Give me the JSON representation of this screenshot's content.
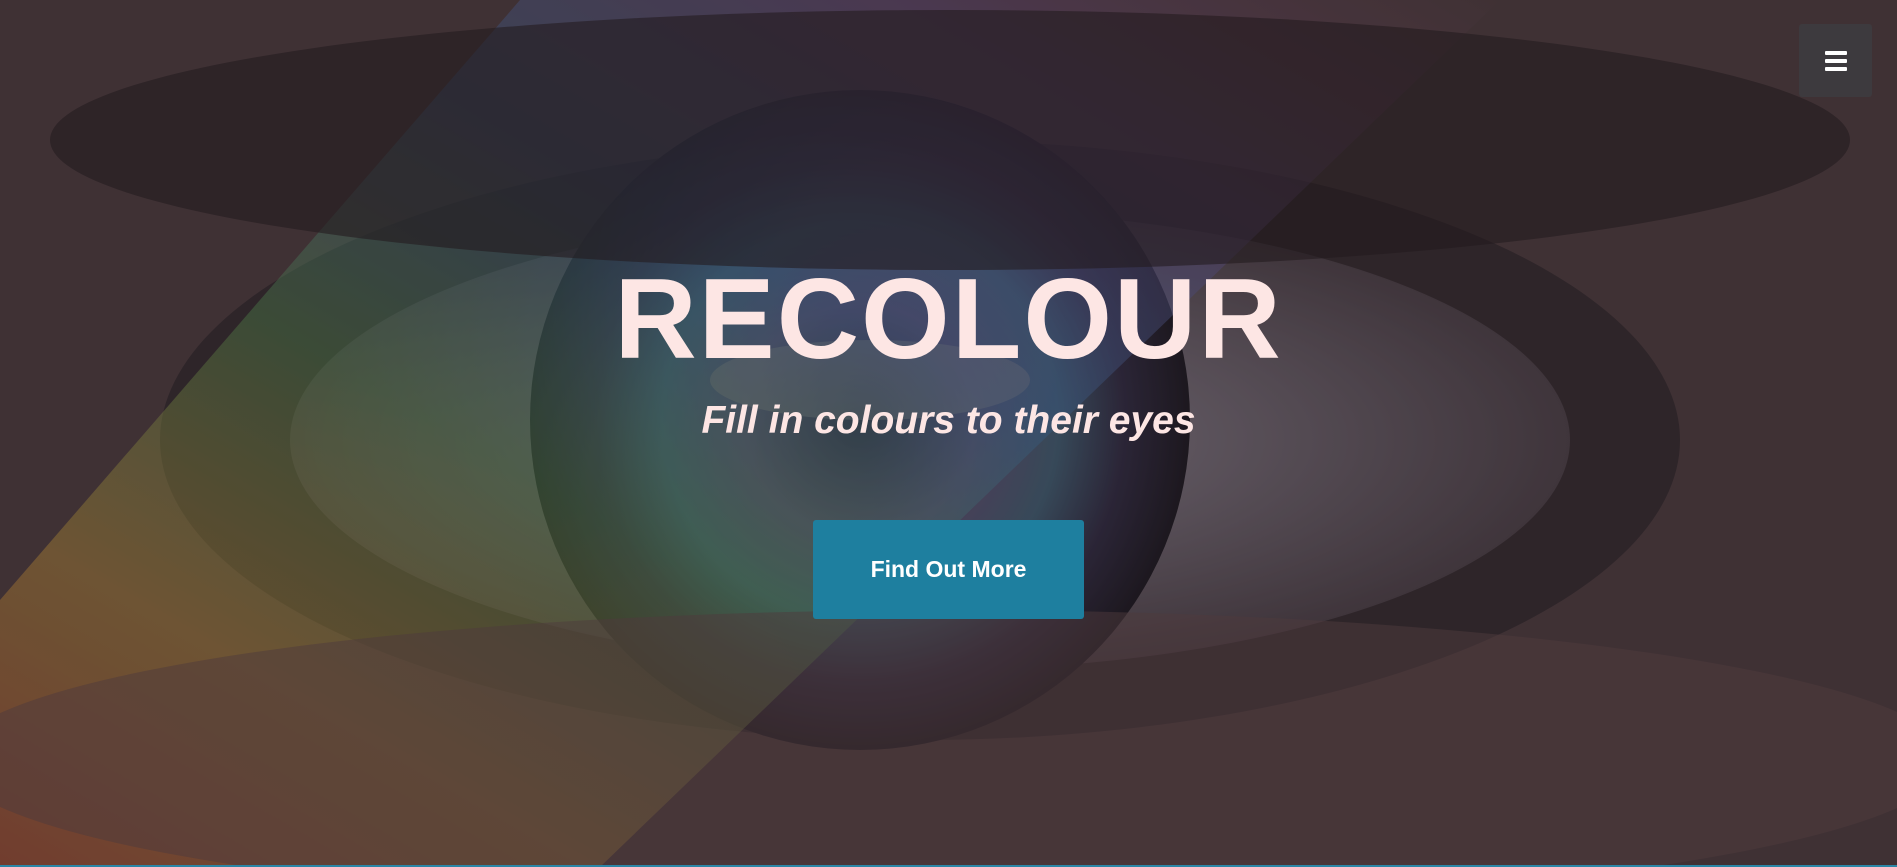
{
  "header": {
    "menu_icon": "hamburger-menu-icon"
  },
  "hero": {
    "title": "RECOLOUR",
    "subtitle": "Fill in colours to their eyes",
    "cta_label": "Find Out More",
    "background_image": "close-up eye with rainbow light",
    "colors": {
      "title": "#fde6e4",
      "cta_background": "#1e7f9f",
      "menu_background": "#3d3a3e"
    }
  }
}
